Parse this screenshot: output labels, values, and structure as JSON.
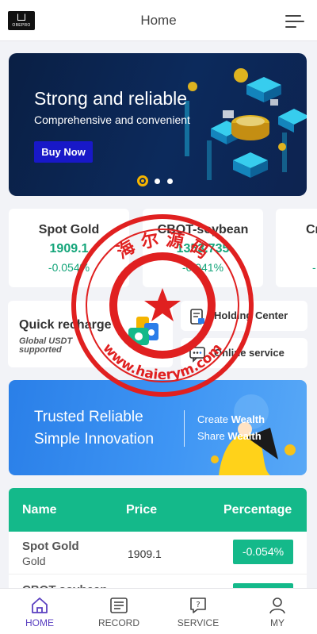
{
  "header": {
    "title": "Home",
    "logo_text": "OBEPRO"
  },
  "banner": {
    "title": "Strong and reliable",
    "subtitle": "Comprehensive and convenient",
    "button_label": "Buy Now",
    "slide_count": 3,
    "active_slide": 1
  },
  "tickers": [
    {
      "name": "Spot Gold",
      "price": "1909.1",
      "change": "-0.054%"
    },
    {
      "name": "CBOT-soybean",
      "price": "1353.735",
      "change": "-0.041%"
    },
    {
      "name": "Cr",
      "price": "",
      "change": "-"
    }
  ],
  "quick": {
    "title": "Quick recharge",
    "subtitle": "Global USDT supported"
  },
  "services": [
    {
      "label": "Holding Center",
      "icon": "document-icon"
    },
    {
      "label": "Online service",
      "icon": "chat-icon"
    }
  ],
  "banner2": {
    "line1": "Trusted Reliable",
    "line2": "Simple Innovation",
    "right1_a": "Create ",
    "right1_b": "Wealth",
    "right2_a": "Share ",
    "right2_b": "Wealth"
  },
  "table": {
    "headers": [
      "Name",
      "Price",
      "Percentage"
    ],
    "rows": [
      {
        "name": "Spot Gold",
        "sub": "Gold",
        "price": "1909.1",
        "pct": "-0.054%"
      },
      {
        "name": "CBOT-soybean",
        "sub": "",
        "price": "",
        "pct": ""
      }
    ]
  },
  "nav": {
    "items": [
      {
        "label": "HOME",
        "icon": "home-icon",
        "active": true
      },
      {
        "label": "RECORD",
        "icon": "record-icon",
        "active": false
      },
      {
        "label": "SERVICE",
        "icon": "help-icon",
        "active": false
      },
      {
        "label": "MY",
        "icon": "user-icon",
        "active": false
      }
    ]
  },
  "watermark": {
    "top_text": "海 尔 源 码",
    "bottom_text": "www.haierym.com"
  },
  "colors": {
    "accent": "#14b98a",
    "up_down": "#14a57a",
    "nav_active": "#5a3fc0",
    "buy_button": "#1818c8",
    "stamp": "#e02020"
  }
}
